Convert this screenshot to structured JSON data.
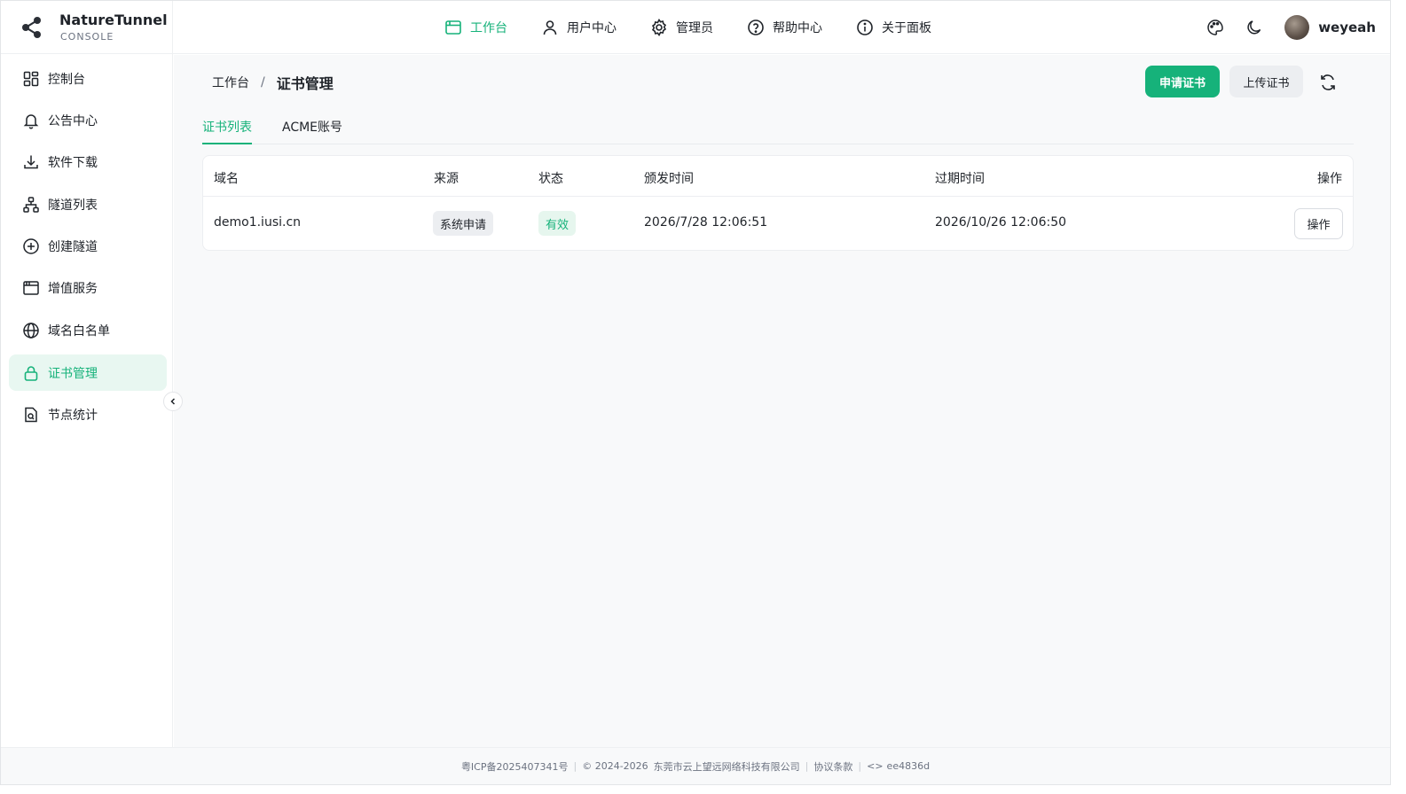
{
  "brand": {
    "name": "NatureTunnel",
    "subtitle": "CONSOLE",
    "logo_icon": "share-nodes-icon"
  },
  "topnav": [
    {
      "label": "工作台",
      "icon": "window-icon",
      "active": true
    },
    {
      "label": "用户中心",
      "icon": "user-icon",
      "active": false
    },
    {
      "label": "管理员",
      "icon": "gear-icon",
      "active": false
    },
    {
      "label": "帮助中心",
      "icon": "help-circle-icon",
      "active": false
    },
    {
      "label": "关于面板",
      "icon": "info-circle-icon",
      "active": false
    }
  ],
  "header_right": {
    "theme_icon": "palette-icon",
    "dark_mode_icon": "moon-icon",
    "username": "weyeah"
  },
  "sidebar": {
    "items": [
      {
        "label": "控制台",
        "icon": "dashboard-icon"
      },
      {
        "label": "公告中心",
        "icon": "bell-icon"
      },
      {
        "label": "软件下载",
        "icon": "download-icon"
      },
      {
        "label": "隧道列表",
        "icon": "sitemap-icon"
      },
      {
        "label": "创建隧道",
        "icon": "plus-circle-icon"
      },
      {
        "label": "增值服务",
        "icon": "browser-window-icon"
      },
      {
        "label": "域名白名单",
        "icon": "globe-icon"
      },
      {
        "label": "证书管理",
        "icon": "lock-icon",
        "active": true
      },
      {
        "label": "节点统计",
        "icon": "file-search-icon"
      }
    ]
  },
  "breadcrumb": {
    "home": "工作台",
    "separator": "/",
    "current": "证书管理"
  },
  "actions": {
    "apply_label": "申请证书",
    "upload_label": "上传证书"
  },
  "tabs": [
    {
      "label": "证书列表",
      "active": true
    },
    {
      "label": "ACME账号",
      "active": false
    }
  ],
  "table": {
    "headers": [
      "域名",
      "来源",
      "状态",
      "颁发时间",
      "过期时间",
      "操作"
    ],
    "rows": [
      {
        "domain": "demo1.iusi.cn",
        "source": "系统申请",
        "status": "有效",
        "issued": "2026/7/28 12:06:51",
        "expires": "2026/10/26 12:06:50",
        "action": "操作"
      }
    ]
  },
  "footer": {
    "icp": "粤ICP备2025407341号",
    "copyright": "© 2024-2026",
    "company": "东莞市云上望远网络科技有限公司",
    "terms": "协议条款",
    "version": "ee4836d"
  },
  "colors": {
    "accent": "#16b27a",
    "accent_bg": "#e8f7f1"
  }
}
